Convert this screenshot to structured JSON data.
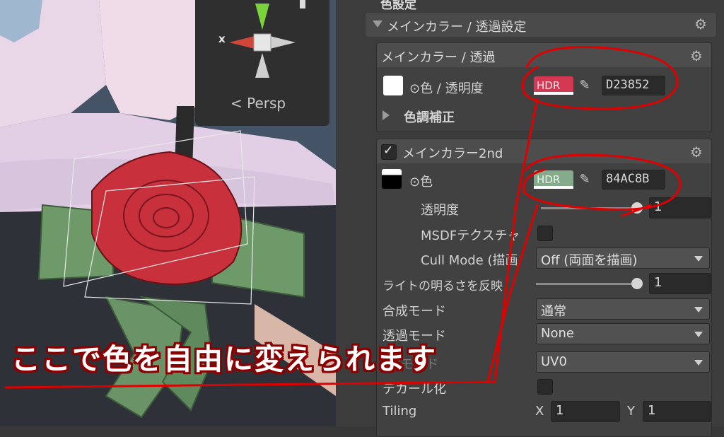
{
  "viewport": {
    "persp_label": "< Persp",
    "axis_x_label": "x"
  },
  "inspector": {
    "section_title": "色設定",
    "main_foldout": "メインカラー / 透過設定",
    "box1": {
      "title": "メインカラー / 透過",
      "color_label": "⊙色 / 透明度",
      "hdr_label": "HDR",
      "hdr_color": "#d23852",
      "hex_value": "D23852",
      "tone_label": "色調補正"
    },
    "box2": {
      "title": "メインカラー2nd",
      "color_label": "⊙色",
      "hdr_label": "HDR",
      "hdr_color": "#84ac8b",
      "hex_value": "84AC8B",
      "alpha_label": "透明度",
      "alpha_value": "1",
      "msdf_label": "MSDFテクスチャ",
      "cull_label": "Cull Mode (描画",
      "cull_value": "Off (両面を描画)",
      "light_label": "ライトの明るさを反映",
      "light_value": "1",
      "blend_label": "合成モード",
      "blend_value": "通常",
      "transp_label": "透過モード",
      "transp_value": "None",
      "uv_label": "UVモード",
      "uv_value": "UV0",
      "decal_label": "デカール化",
      "tiling_label": "Tiling",
      "tiling_x_label": "X",
      "tiling_x_value": "1",
      "tiling_y_label": "Y",
      "tiling_y_value": "1"
    }
  },
  "annotation": {
    "caption": "ここで色を自由に変えられます",
    "color": "#e00000"
  }
}
